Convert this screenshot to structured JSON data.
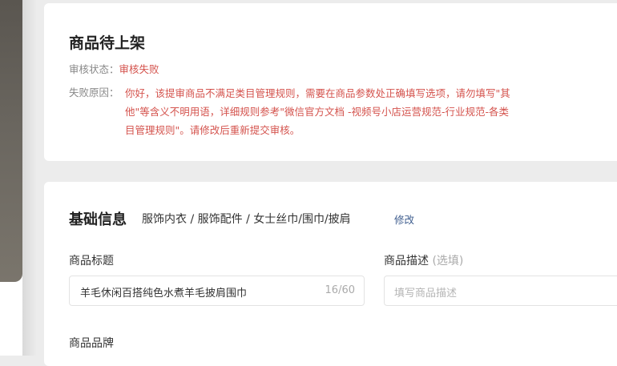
{
  "status_card": {
    "title": "商品待上架",
    "review_label": "审核状态：",
    "review_value": "审核失败",
    "reason_label": "失败原因：",
    "reason_text": "你好，该提审商品不满足类目管理规则，需要在商品参数处正确填写选项，请勿填写\"其他\"等含义不明用语，详细规则参考\"微信官方文档 -视频号小店运营规范-行业规范-各类目管理规则\"。请修改后重新提交审核。"
  },
  "basic_card": {
    "title": "基础信息",
    "category": "服饰内衣 / 服饰配件 / 女士丝巾/围巾/披肩",
    "edit_label": "修改",
    "product_title_label": "商品标题",
    "product_title_value": "羊毛休闲百搭纯色水煮羊毛披肩围巾",
    "product_title_count": "16/60",
    "description_label": "商品描述",
    "description_optional": "(选填)",
    "description_placeholder": "填写商品描述",
    "brand_label": "商品品牌"
  },
  "colors": {
    "error_red": "#d4534d",
    "link_blue": "#3e5d8e",
    "background": "#ececec"
  }
}
